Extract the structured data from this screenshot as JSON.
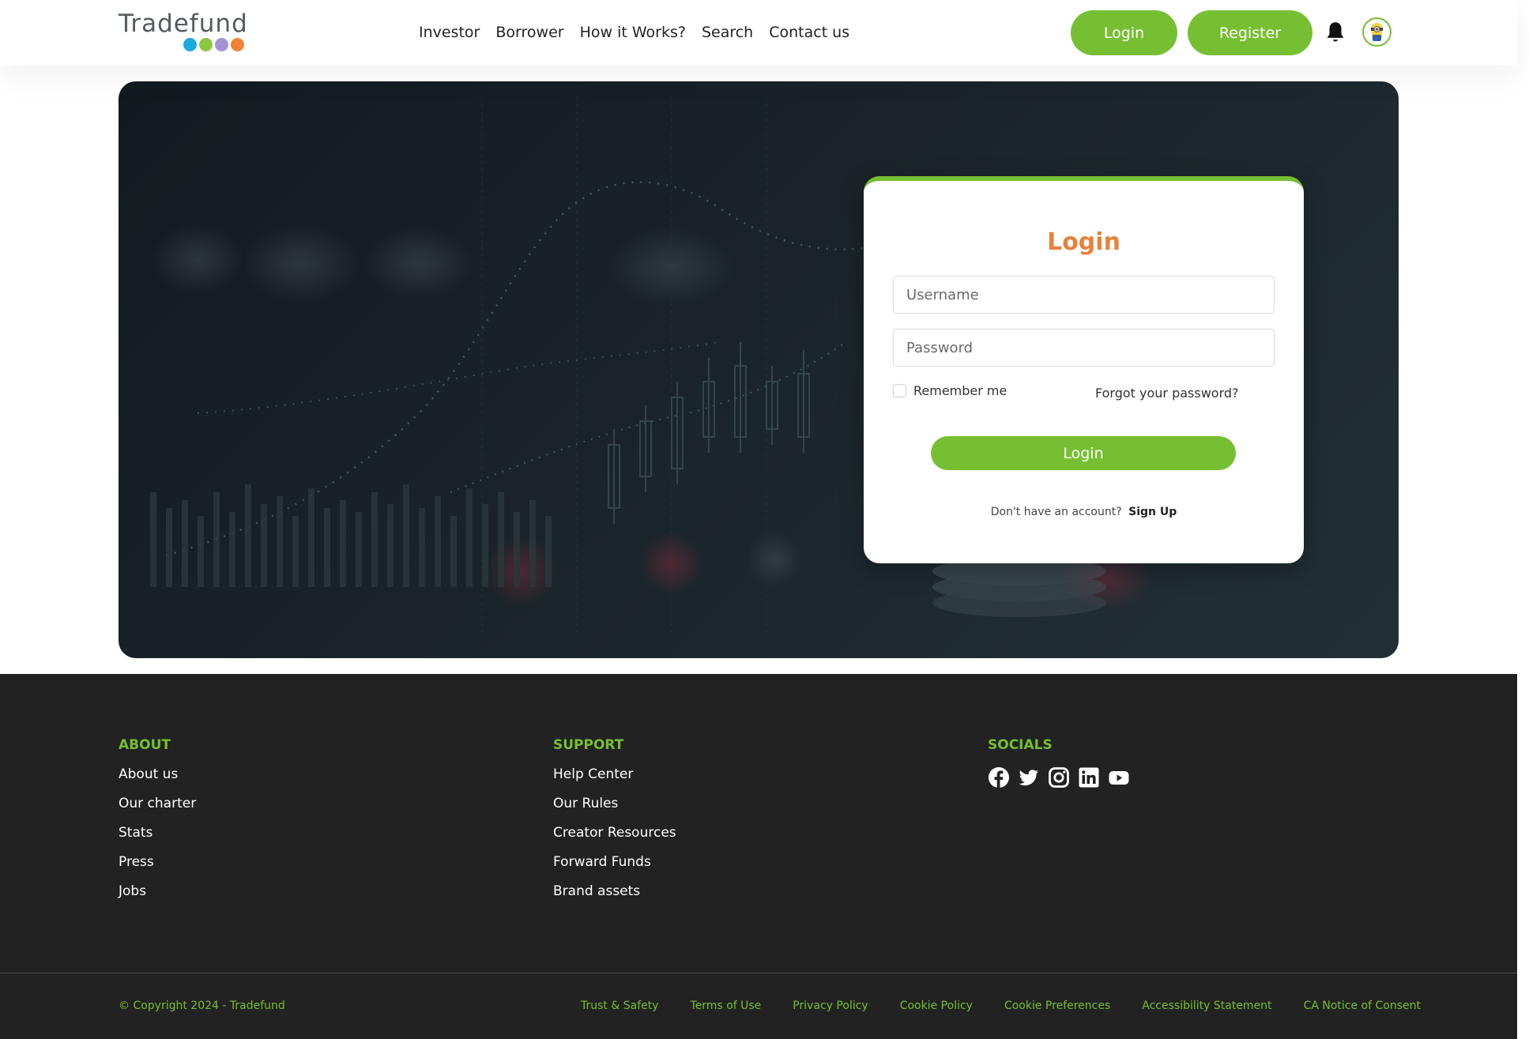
{
  "brand": {
    "name": "Tradefund",
    "dot_colors": [
      "#1ba9e1",
      "#8cc63f",
      "#a394d4",
      "#ee8434"
    ]
  },
  "nav": {
    "items": [
      "Investor",
      "Borrower",
      "How it Works?",
      "Search",
      "Contact us"
    ]
  },
  "header": {
    "login_label": "Login",
    "register_label": "Register",
    "bell_icon": "bell-icon",
    "avatar_icon": "user-avatar-icon"
  },
  "login_form": {
    "title": "Login",
    "username_placeholder": "Username",
    "password_placeholder": "Password",
    "remember_label": "Remember me",
    "forgot_label": "Forgot your password?",
    "submit_label": "Login",
    "signup_prompt": "Don't have an account?",
    "signup_link": "Sign Up"
  },
  "footer": {
    "about": {
      "heading": "ABOUT",
      "links": [
        "About us",
        "Our charter",
        "Stats",
        "Press",
        "Jobs"
      ]
    },
    "support": {
      "heading": "SUPPORT",
      "links": [
        "Help Center",
        "Our Rules",
        "Creator Resources",
        "Forward Funds",
        "Brand assets"
      ]
    },
    "socials": {
      "heading": "SOCIALS",
      "icons": [
        "facebook-icon",
        "twitter-icon",
        "instagram-icon",
        "linkedin-icon",
        "youtube-icon"
      ]
    },
    "copyright": "© Copyright 2024 - Tradefund",
    "legal_links": [
      "Trust & Safety",
      "Terms of Use",
      "Privacy Policy",
      "Cookie Policy",
      "Cookie Preferences",
      "Accessibility Statement",
      "CA Notice of Consent"
    ]
  },
  "colors": {
    "accent_green": "#76bf32",
    "title_orange": "#e8813a",
    "footer_bg": "#222222"
  }
}
